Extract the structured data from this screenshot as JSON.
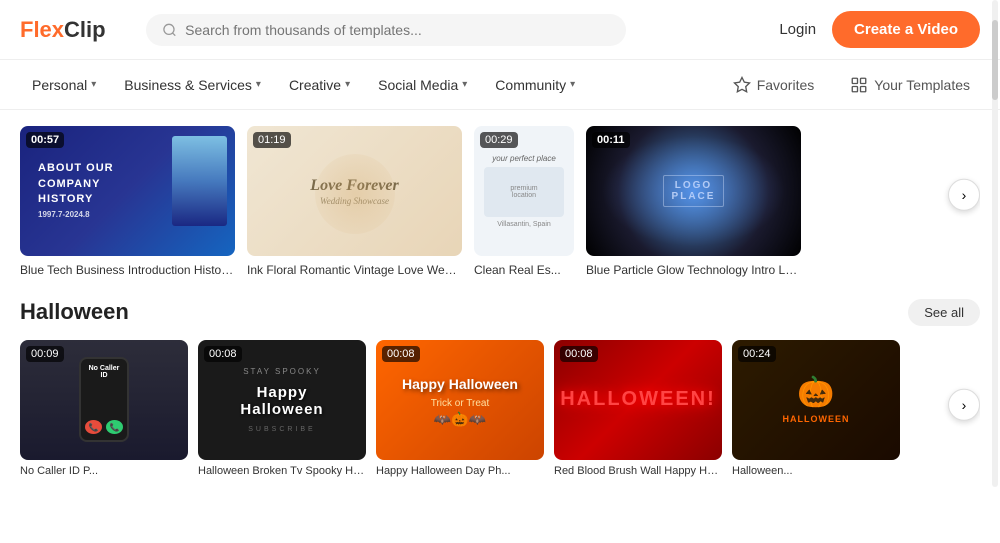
{
  "logo": {
    "flex": "Flex",
    "clip": "Clip"
  },
  "search": {
    "placeholder": "Search from thousands of templates..."
  },
  "header": {
    "login_label": "Login",
    "create_label": "Create a Video"
  },
  "nav": {
    "items": [
      {
        "id": "personal",
        "label": "Personal"
      },
      {
        "id": "business",
        "label": "Business & Services"
      },
      {
        "id": "creative",
        "label": "Creative"
      },
      {
        "id": "social",
        "label": "Social Media"
      },
      {
        "id": "community",
        "label": "Community"
      }
    ],
    "favorites_label": "Favorites",
    "your_templates_label": "Your Templates"
  },
  "featured_templates": [
    {
      "duration": "00:57",
      "title": "Blue Tech Business Introduction History Timeli...",
      "style": "blue-tech"
    },
    {
      "duration": "01:19",
      "title": "Ink Floral Romantic Vintage Love Wedding Ann...",
      "style": "wedding"
    },
    {
      "duration": "00:29",
      "title": "Clean Real Es...",
      "style": "clean"
    },
    {
      "duration": "00:11",
      "title": "Blue Particle Glow Technology Intro Logo",
      "style": "particle"
    }
  ],
  "halloween": {
    "section_title": "Halloween",
    "see_all_label": "See all",
    "templates": [
      {
        "duration": "00:09",
        "title": "No Caller ID P...",
        "style": "hw-phone",
        "text": "No Caller ID"
      },
      {
        "duration": "00:08",
        "title": "Halloween Broken Tv Spooky Haunted House...",
        "style": "hw-tv",
        "text": "Happy Halloween"
      },
      {
        "duration": "00:08",
        "title": "Happy Halloween Day Ph...",
        "style": "hw-orange",
        "text": "Happy Halloween"
      },
      {
        "duration": "00:08",
        "title": "Red Blood Brush Wall Happy Halloween Scary...",
        "style": "hw-red",
        "text": "HALLOWEEN!"
      },
      {
        "duration": "00:24",
        "title": "Halloween...",
        "style": "hw-dark",
        "text": "🎃"
      }
    ]
  }
}
